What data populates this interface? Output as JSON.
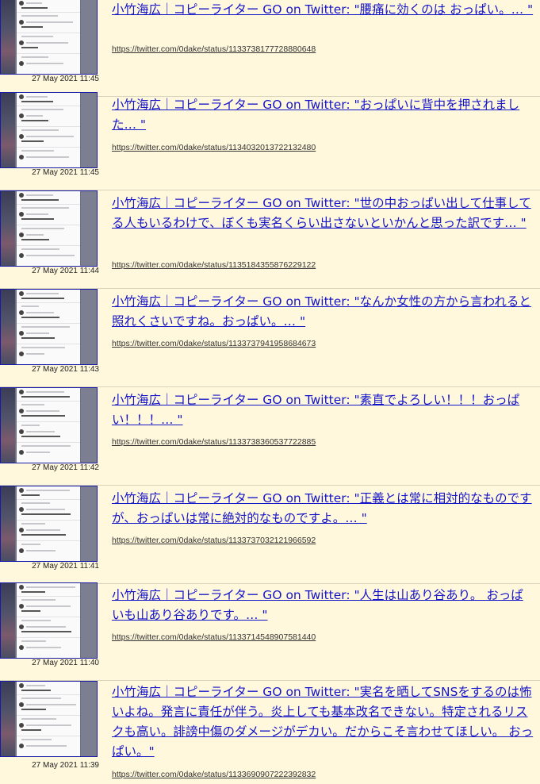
{
  "items": [
    {
      "title": "小竹海広｜コピーライター GO on Twitter: \"腰痛に効くのは おっぱい。… \"",
      "url": "https://twitter.com/0dake/status/1133738177728880648",
      "date": "27 May 2021 11:45"
    },
    {
      "title": "小竹海広｜コピーライター GO on Twitter: \"おっぱいに背中を押されました… \"",
      "url": "https://twitter.com/0dake/status/1134032013722132480",
      "date": "27 May 2021 11:45"
    },
    {
      "title": "小竹海広｜コピーライター GO on Twitter: \"世の中おっぱい出して仕事してる人もいるわけで、ぼくも実名くらい出さないといかんと思った訳です… \"",
      "url": "https://twitter.com/0dake/status/1135184355876229122",
      "date": "27 May 2021 11:44"
    },
    {
      "title": "小竹海広｜コピーライター GO on Twitter: \"なんか女性の方から言われると照れくさいですね。おっぱい。… \"",
      "url": "https://twitter.com/0dake/status/1133737941958684673",
      "date": "27 May 2021 11:43"
    },
    {
      "title": "小竹海広｜コピーライター GO on Twitter: \"素直でよろしい！！！おっぱい！！！… \"",
      "url": "https://twitter.com/0dake/status/1133738360537722885",
      "date": "27 May 2021 11:42"
    },
    {
      "title": "小竹海広｜コピーライター GO on Twitter: \"正義とは常に相対的なものですが、おっぱいは常に絶対的なものですよ。… \"",
      "url": "https://twitter.com/0dake/status/1133737032121966592",
      "date": "27 May 2021 11:41"
    },
    {
      "title": "小竹海広｜コピーライター GO on Twitter: \"人生は山あり谷あり。 おっぱいも山あり谷ありです。… \"",
      "url": "https://twitter.com/0dake/status/1133714548907581440",
      "date": "27 May 2021 11:40"
    },
    {
      "title": "小竹海広｜コピーライター GO on Twitter: \"実名を晒してSNSをするのは怖いよね。発言に責任が伴う。炎上しても基本改名できない。特定されるリスクも高い。誹謗中傷のダメージがデカい。だからこそ言わせてほしい。 おっぱい。\"",
      "url": "https://twitter.com/0dake/status/1133690907222392832",
      "date": "27 May 2021 11:39"
    }
  ]
}
